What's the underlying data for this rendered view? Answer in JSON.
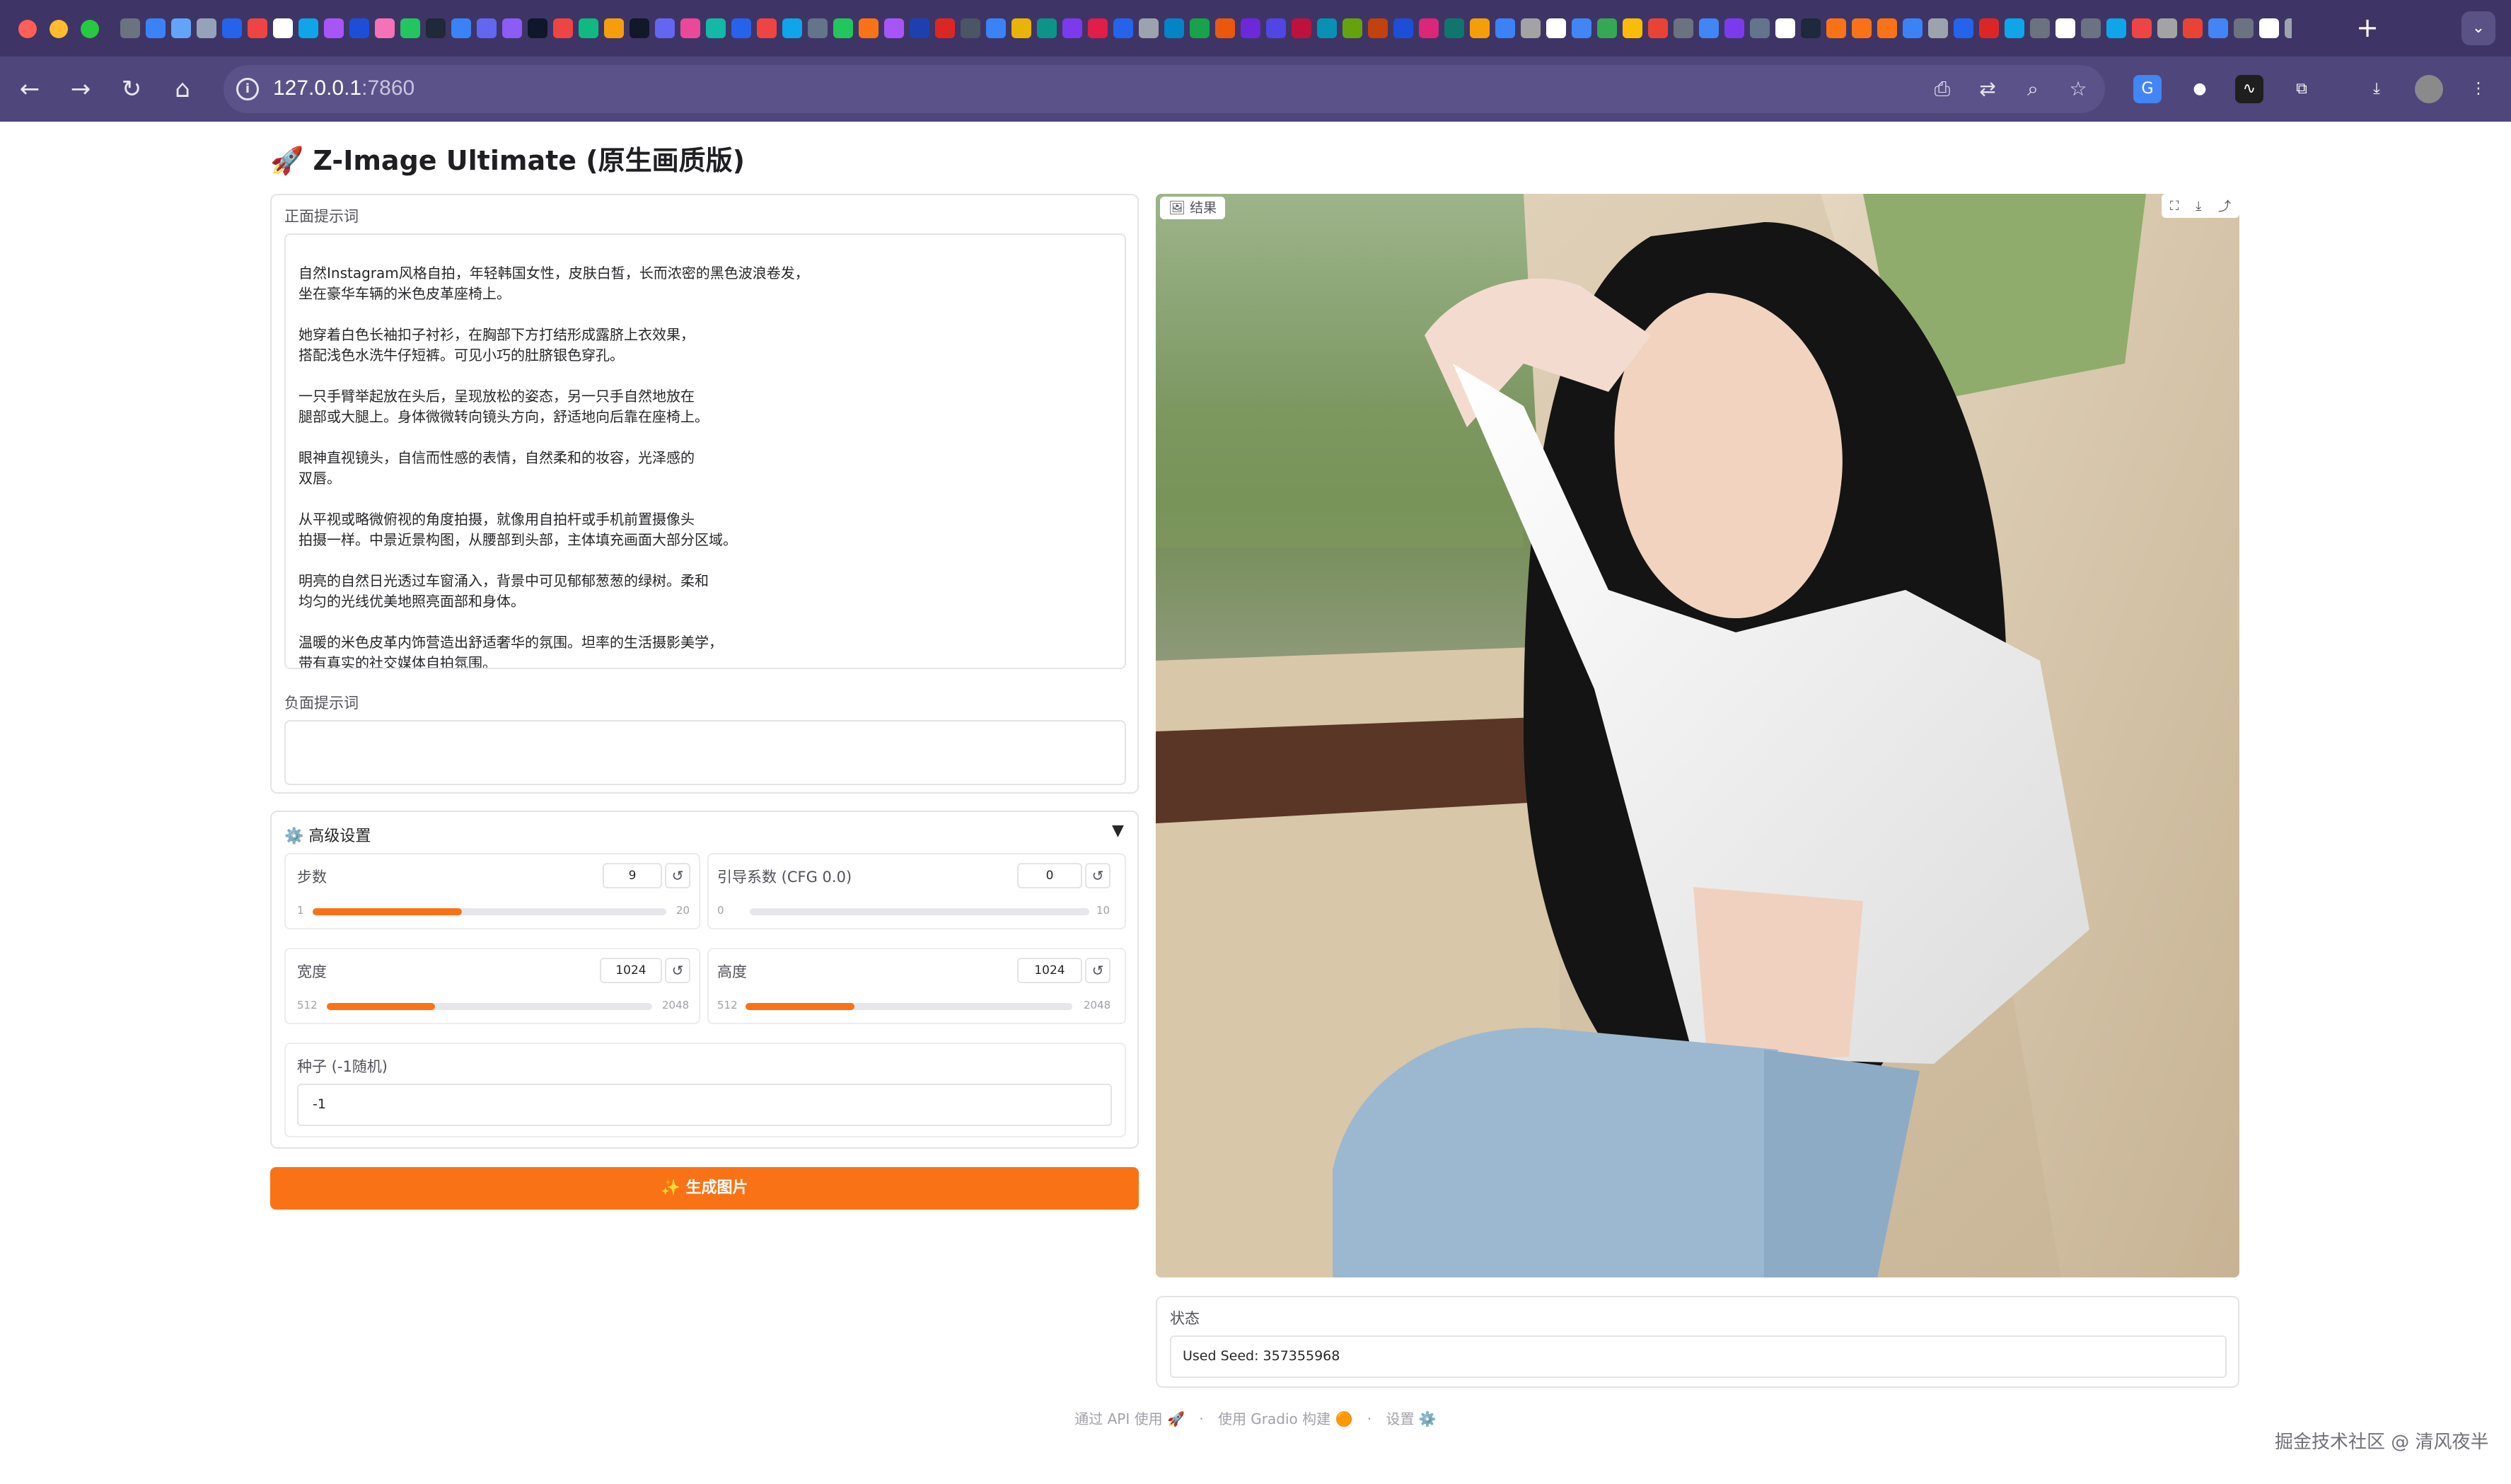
{
  "browser": {
    "url_host": "127.0.0.1",
    "url_port": ":7860",
    "new_tab": "+",
    "tab_menu": "⌄",
    "favicon_colors": [
      "#6b7280",
      "#3b82f6",
      "#60a5fa",
      "#94a3b8",
      "#2563eb",
      "#ef4444",
      "#ffffff",
      "#0ea5e9",
      "#a855f7",
      "#1d4ed8",
      "#f472b6",
      "#22c55e",
      "#1f2937",
      "#3b82f6",
      "#6366f1",
      "#8b5cf6",
      "#0f172a",
      "#ef4444",
      "#10b981",
      "#f59e0b",
      "#111827",
      "#6366f1",
      "#ec4899",
      "#14b8a6",
      "#2563eb",
      "#ef4444",
      "#0ea5e9",
      "#64748b",
      "#22c55e",
      "#f97316",
      "#a855f7",
      "#1e40af",
      "#dc2626",
      "#4b5563",
      "#3b82f6",
      "#eab308",
      "#0d9488",
      "#7c3aed",
      "#e11d48",
      "#2563eb",
      "#9ca3af",
      "#0284c7",
      "#16a34a",
      "#ea580c",
      "#6d28d9",
      "#4f46e5",
      "#be123c",
      "#0891b2",
      "#65a30d",
      "#c2410c",
      "#1d4ed8",
      "#db2777",
      "#0f766e",
      "#f59e0b",
      "#3b82f6",
      "#a3a3a3",
      "#ffffff",
      "#4285f4",
      "#34a853",
      "#fbbc05",
      "#ea4335",
      "#6b7280",
      "#4285f4",
      "#7c3aed",
      "#64748b",
      "#ffffff",
      "#1e293b",
      "#f97316",
      "#f97316",
      "#f97316",
      "#3b82f6",
      "#9ca3af",
      "#2563eb",
      "#dc2626",
      "#0ea5e9",
      "#6b7280",
      "#ffffff",
      "#6b7280",
      "#0ea5e9",
      "#ef4444",
      "#a3a3a3",
      "#ea4335",
      "#4285f4",
      "#6b7280",
      "#ffffff",
      "#9ca3af",
      "#7c3aed",
      "#ffffff",
      "#94a3b8",
      "#4285f4"
    ]
  },
  "page": {
    "title": "🚀 Z-Image Ultimate (原生画质版)"
  },
  "positive": {
    "label": "正面提示词",
    "value": "自然Instagram风格自拍，年轻韩国女性，皮肤白皙，长而浓密的黑色波浪卷发，\n坐在豪华车辆的米色皮革座椅上。\n\n她穿着白色长袖扣子衬衫，在胸部下方打结形成露脐上衣效果，\n搭配浅色水洗牛仔短裤。可见小巧的肚脐银色穿孔。\n\n一只手臂举起放在头后，呈现放松的姿态，另一只手自然地放在\n腿部或大腿上。身体微微转向镜头方向，舒适地向后靠在座椅上。\n\n眼神直视镜头，自信而性感的表情，自然柔和的妆容，光泽感的\n双唇。\n\n从平视或略微俯视的角度拍摄，就像用自拍杆或手机前置摄像头\n拍摄一样。中景近景构图，从腰部到头部，主体填充画面大部分区域。\n\n明亮的自然日光透过车窗涌入，背景中可见郁郁葱葱的绿树。柔和\n均匀的光线优美地照亮面部和身体。\n\n温暖的米色皮革内饰营造出舒适奢华的氛围。坦率的生活摄影美学，\n带有真实的社交媒体自拍氛围。"
  },
  "negative": {
    "label": "负面提示词",
    "value": ""
  },
  "advanced": {
    "title": "⚙️ 高级设置",
    "caret": "▼",
    "steps": {
      "label": "步数",
      "value": "9",
      "min": "1",
      "max": "20",
      "num": 9,
      "lo": 1,
      "hi": 20
    },
    "cfg": {
      "label": "引导系数 (CFG 0.0)",
      "value": "0",
      "min": "0",
      "max": "10",
      "num": 0,
      "lo": 0,
      "hi": 10
    },
    "width": {
      "label": "宽度",
      "value": "1024",
      "min": "512",
      "max": "2048",
      "num": 1024,
      "lo": 512,
      "hi": 2048
    },
    "height": {
      "label": "高度",
      "value": "1024",
      "min": "512",
      "max": "2048",
      "num": 1024,
      "lo": 512,
      "hi": 2048
    },
    "seed": {
      "label": "种子 (-1随机)",
      "value": "-1"
    },
    "reset_glyph": "↺"
  },
  "generate": {
    "label": "✨ 生成图片"
  },
  "result": {
    "label": "🖼 结果",
    "tools": [
      "⛶",
      "⤓",
      "⤴"
    ]
  },
  "status": {
    "label": "状态",
    "value": "Used Seed: 357355968"
  },
  "footer": {
    "api": "通过 API 使用 🚀",
    "sep1": "·",
    "built": "使用 Gradio 构建 🟠",
    "sep2": "·",
    "settings": "设置 ⚙️"
  },
  "watermark": "掘金技术社区 @ 清风夜半"
}
